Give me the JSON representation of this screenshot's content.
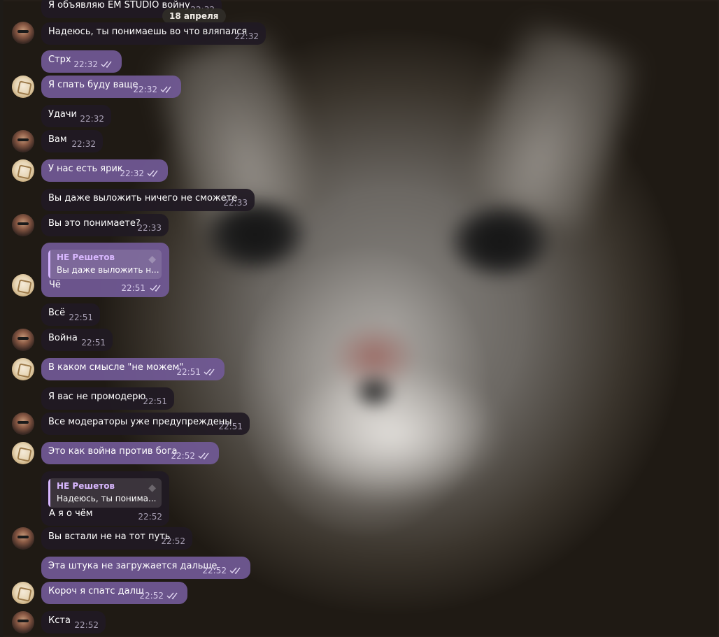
{
  "date_separator": "18 апреля",
  "messages": [
    {
      "text": "Я объявляю EM STUDIO войну",
      "time": "22:32",
      "dir": "in"
    },
    {
      "text": "Надеюсь, ты понимаешь во что вляпался",
      "time": "22:32",
      "dir": "in"
    },
    {
      "text": "Стрх",
      "time": "22:32",
      "dir": "out"
    },
    {
      "text": "Я спать буду ваще",
      "time": "22:32",
      "dir": "out"
    },
    {
      "text": "Удачи",
      "time": "22:32",
      "dir": "in"
    },
    {
      "text": "Вам",
      "time": "22:32",
      "dir": "in"
    },
    {
      "text": "У нас есть ярик",
      "time": "22:32",
      "dir": "out"
    },
    {
      "text": "Вы даже выложить ничего не сможете",
      "time": "22:33",
      "dir": "in"
    },
    {
      "text": "Вы это понимаете?",
      "time": "22:33",
      "dir": "in"
    },
    {
      "text": "Всё",
      "time": "22:51",
      "dir": "in"
    },
    {
      "text": "Война",
      "time": "22:51",
      "dir": "in"
    },
    {
      "text": "В каком смысле \"не можем\"",
      "time": "22:51",
      "dir": "out"
    },
    {
      "text": "Я вас не промодерю",
      "time": "22:51",
      "dir": "in"
    },
    {
      "text": "Все модераторы уже предупреждены",
      "time": "22:51",
      "dir": "in"
    },
    {
      "text": "Это как война против бога",
      "time": "22:52",
      "dir": "out"
    },
    {
      "text": "Вы встали не на тот путь",
      "time": "22:52",
      "dir": "in"
    },
    {
      "text": "Эта штука не загружается дальше",
      "time": "22:52",
      "dir": "out"
    },
    {
      "text": "Короч я спатс далш",
      "time": "22:52",
      "dir": "out"
    },
    {
      "text": "Кста",
      "time": "22:52",
      "dir": "in"
    }
  ],
  "replies": [
    {
      "quote_name": "НЕ Решетов",
      "quote_text": "Вы даже выложить н...",
      "text": "Чё",
      "time": "22:51",
      "dir": "out"
    },
    {
      "quote_name": "НЕ Решетов",
      "quote_text": "Надеюсь, ты понима...",
      "text": "А я о чём",
      "time": "22:52",
      "dir": "in"
    }
  ],
  "colors": {
    "incoming_bubble": "#201a24",
    "outgoing_bubble": "#715996",
    "quote_accent": "#d6b6ff"
  }
}
